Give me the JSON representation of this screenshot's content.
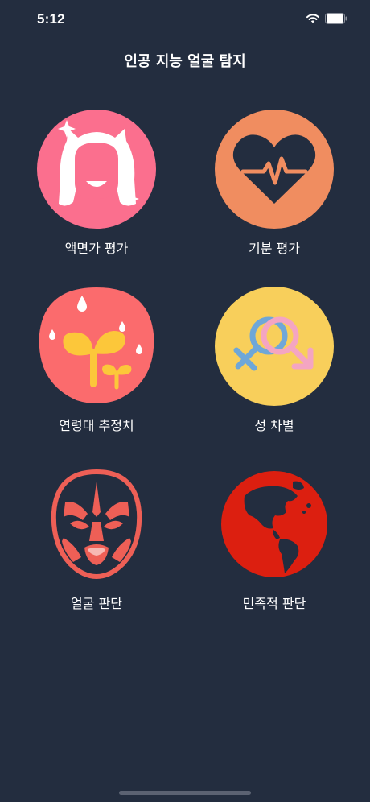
{
  "status_bar": {
    "time": "5:12"
  },
  "header": {
    "title": "인공 지능 얼굴 탐지"
  },
  "menu": {
    "items": [
      {
        "label": "액면가 평가",
        "icon": "cartoon-face-icon",
        "color": "#fb6f8e"
      },
      {
        "label": "기분 평가",
        "icon": "heartbeat-icon",
        "color": "#f08d60"
      },
      {
        "label": "연령대 추정치",
        "icon": "sprout-icon",
        "color": "#fb6b6d"
      },
      {
        "label": "성 차별",
        "icon": "gender-symbols-icon",
        "color": "#f8cf5b"
      },
      {
        "label": "얼굴 판단",
        "icon": "opera-mask-icon",
        "color": "#ee5f56"
      },
      {
        "label": "민족적 판단",
        "icon": "globe-icon",
        "color": "#dc1f10"
      }
    ]
  },
  "colors": {
    "background": "#232d3f",
    "text": "#ffffff"
  }
}
